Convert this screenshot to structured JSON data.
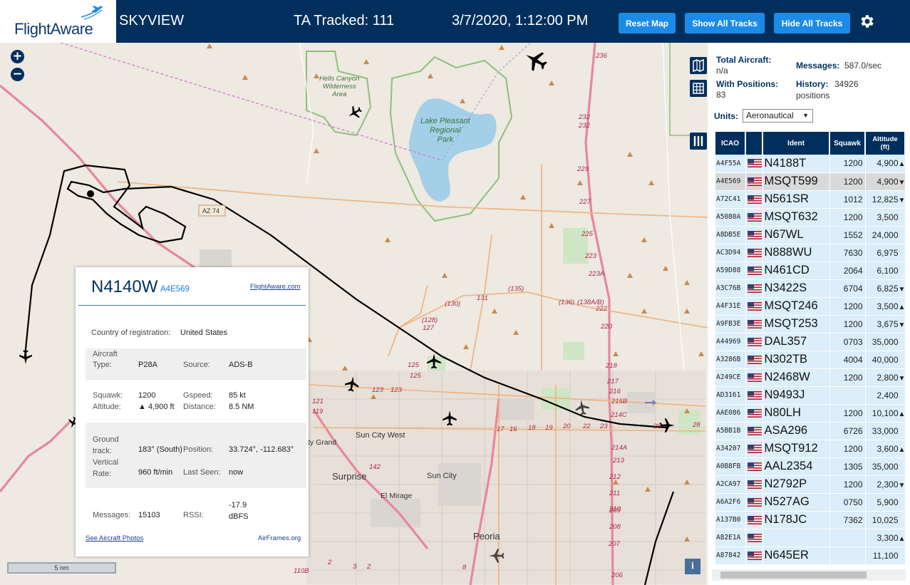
{
  "header": {
    "logo_text": "FlightAware",
    "site_name": "SKYVIEW",
    "ta_tracked": "TA Tracked: 111",
    "clock": "3/7/2020, 1:12:00 PM",
    "buttons": {
      "reset_map": "Reset Map",
      "show_all_tracks": "Show All Tracks",
      "hide_all_tracks": "Hide All Tracks"
    }
  },
  "map": {
    "zoom_in": "+",
    "zoom_out": "−",
    "scale_label": "5 nm",
    "info_button": "i",
    "labels": {
      "hells_canyon": "Hells Canyon\nWilderness\nArea",
      "lake_pleasant": "Lake Pleasant\nRegional\nPark",
      "az74": "AZ 74",
      "sun_city_west": "Sun City West",
      "surprise": "Surprise",
      "sun_city": "Sun City",
      "el_mirage": "El Mirage",
      "peoria": "Peoria",
      "city_grand": "ty Grand"
    },
    "road_numbers": [
      "236",
      "232",
      "232",
      "229",
      "227",
      "225",
      "223",
      "223A",
      "222",
      "220",
      "218",
      "217",
      "216",
      "215B",
      "214C",
      "214A",
      "213",
      "212",
      "211",
      "210",
      "209",
      "208",
      "207",
      "206",
      "(128)",
      "127",
      "(130)",
      "131",
      "(135)",
      "(136)",
      "(138A/B)",
      "125",
      "125",
      "123",
      "123",
      "121",
      "119",
      "17",
      "16",
      "18",
      "19",
      "20",
      "22",
      "23",
      "26",
      "28",
      "142",
      "110B",
      "2",
      "3",
      "2",
      "8"
    ]
  },
  "infoblock": {
    "ident": "N4140W",
    "icao": "A4E569",
    "flightaware_link": "FlightAware.com",
    "country_label": "Country of registration:",
    "country_value": "United States",
    "aircraft_type_label": "Aircraft\nType:",
    "aircraft_type_value": "P28A",
    "source_label": "Source:",
    "source_value": "ADS-B",
    "squawk_label": "Squawk:",
    "squawk_value": "1200",
    "gspeed_label": "Gspeed:",
    "gspeed_value": "85 kt",
    "altitude_label": "Altitude:",
    "altitude_value": "▲ 4,900 ft",
    "distance_label": "Distance:",
    "distance_value": "8.5 NM",
    "ground_track_label": "Ground\ntrack:",
    "ground_track_value": "183° (South)",
    "position_label": "Position:",
    "position_value": "33.724°, -112.683°",
    "vertical_rate_label": "Vertical\nRate:",
    "vertical_rate_value": "960 ft/min",
    "last_seen_label": "Last Seen:",
    "last_seen_value": "now",
    "messages_label": "Messages:",
    "messages_value": "15103",
    "rssi_label": "RSSI:",
    "rssi_value": "-17.9\ndBFS",
    "photos_link": "See Aircraft Photos",
    "airframes_link": "AirFrames.org"
  },
  "sidebar": {
    "total_aircraft_label": "Total Aircraft:",
    "total_aircraft_value": "n/a",
    "with_positions_label": "With Positions:",
    "with_positions_value": "83",
    "messages_label": "Messages:",
    "messages_value": "587.0/sec",
    "history_label": "History:",
    "history_value": "34926",
    "history_unit": "positions",
    "units_label": "Units:",
    "units_value": "Aeronautical",
    "table_headers": {
      "icao": "ICAO",
      "flag": "",
      "ident": "Ident",
      "squawk": "Squawk",
      "altitude": "Altitude\n(ft)"
    },
    "rows": [
      {
        "icao": "A4F55A",
        "ident": "N4188T",
        "squawk": "1200",
        "altitude": "4,900",
        "trend": "▲"
      },
      {
        "icao": "A4E569",
        "ident": "MSQT599",
        "squawk": "1200",
        "altitude": "4,900",
        "trend": "▼"
      },
      {
        "icao": "A72C41",
        "ident": "N561SR",
        "squawk": "1012",
        "altitude": "12,825",
        "trend": "▼"
      },
      {
        "icao": "A5080A",
        "ident": "MSQT632",
        "squawk": "1200",
        "altitude": "3,500",
        "trend": ""
      },
      {
        "icao": "A8DB5E",
        "ident": "N67WL",
        "squawk": "1552",
        "altitude": "24,000",
        "trend": ""
      },
      {
        "icao": "AC3D94",
        "ident": "N888WU",
        "squawk": "7630",
        "altitude": "6,975",
        "trend": ""
      },
      {
        "icao": "A59D88",
        "ident": "N461CD",
        "squawk": "2064",
        "altitude": "6,100",
        "trend": ""
      },
      {
        "icao": "A3C76B",
        "ident": "N3422S",
        "squawk": "6704",
        "altitude": "6,825",
        "trend": "▼"
      },
      {
        "icao": "A4F31E",
        "ident": "MSQT246",
        "squawk": "1200",
        "altitude": "3,500",
        "trend": "▲"
      },
      {
        "icao": "A9FB3E",
        "ident": "MSQT253",
        "squawk": "1200",
        "altitude": "3,675",
        "trend": "▼"
      },
      {
        "icao": "A44969",
        "ident": "DAL357",
        "squawk": "0703",
        "altitude": "35,000",
        "trend": ""
      },
      {
        "icao": "A3286B",
        "ident": "N302TB",
        "squawk": "4004",
        "altitude": "40,000",
        "trend": ""
      },
      {
        "icao": "A249CE",
        "ident": "N2468W",
        "squawk": "1200",
        "altitude": "2,800",
        "trend": "▼"
      },
      {
        "icao": "AD3161",
        "ident": "N9493J",
        "squawk": "",
        "altitude": "2,400",
        "trend": ""
      },
      {
        "icao": "AAE086",
        "ident": "N80LH",
        "squawk": "1200",
        "altitude": "10,100",
        "trend": "▲"
      },
      {
        "icao": "A5BB1B",
        "ident": "ASA296",
        "squawk": "6726",
        "altitude": "33,000",
        "trend": ""
      },
      {
        "icao": "A34207",
        "ident": "MSQT912",
        "squawk": "1200",
        "altitude": "3,600",
        "trend": "▲"
      },
      {
        "icao": "A0B8FB",
        "ident": "AAL2354",
        "squawk": "1305",
        "altitude": "35,000",
        "trend": ""
      },
      {
        "icao": "A2CA97",
        "ident": "N2792P",
        "squawk": "1200",
        "altitude": "2,300",
        "trend": "▼"
      },
      {
        "icao": "A6A2F6",
        "ident": "N527AG",
        "squawk": "0750",
        "altitude": "5,900",
        "trend": ""
      },
      {
        "icao": "A137B0",
        "ident": "N178JC",
        "squawk": "7362",
        "altitude": "10,025",
        "trend": ""
      },
      {
        "icao": "A82E1A",
        "ident": "",
        "squawk": "",
        "altitude": "3,300",
        "trend": "▲"
      },
      {
        "icao": "A87842",
        "ident": "N645ER",
        "squawk": "",
        "altitude": "11,100",
        "trend": ""
      }
    ]
  },
  "colors": {
    "header_bg": "#002f5d",
    "button_bg": "#1c8be8",
    "table_row_bg": "#dbeefa",
    "selected_row_bg": "#d9d9d9",
    "track_line": "#000000",
    "highway": "#e8879a",
    "park_boundary": "#8ec07c",
    "lake": "#a4cfe8"
  },
  "icons": [
    "settings-gear-icon",
    "map-layers-icon",
    "grid-icon",
    "columns-icon",
    "info-icon",
    "us-flag-icon",
    "airplane-icon",
    "flightaware-plane-logo"
  ]
}
